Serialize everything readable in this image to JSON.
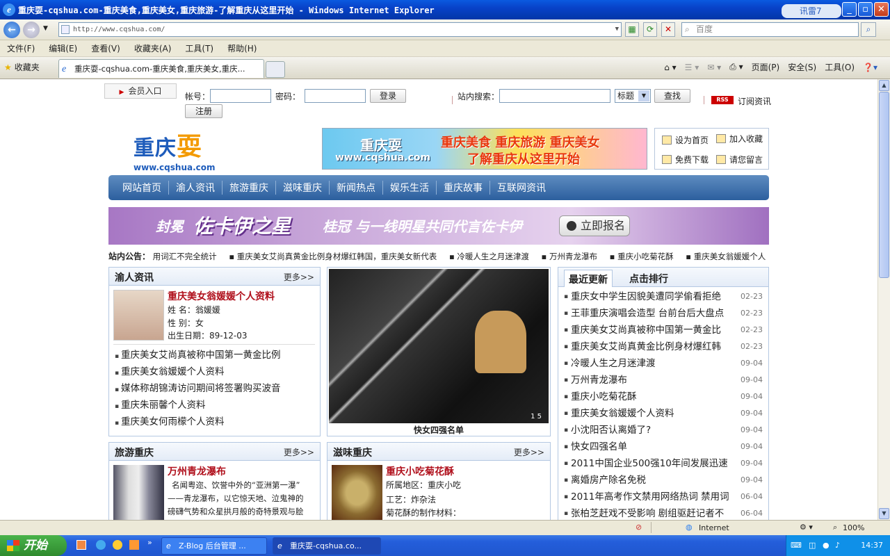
{
  "window": {
    "title": "重庆耍-cqshua.com-重庆美食,重庆美女,重庆旅游-了解重庆从这里开始 - Windows Internet Explorer",
    "xunlei": "讯雷7"
  },
  "browser": {
    "address": "http://www.cqshua.com/",
    "search_placeholder": "百度",
    "menus": [
      "文件(F)",
      "编辑(E)",
      "查看(V)",
      "收藏夹(A)",
      "工具(T)",
      "帮助(H)"
    ],
    "favorites": "收藏夹",
    "tab_title": "重庆耍-cqshua.com-重庆美食,重庆美女,重庆...",
    "cmd": {
      "page": "页面(P)",
      "safety": "安全(S)",
      "tools": "工具(O)"
    }
  },
  "page": {
    "member": "会员入口",
    "account_label": "帐号：",
    "password_label": "密码：",
    "login": "登录",
    "register": "注册",
    "site_search_label": "站内搜索：",
    "search_type": "标题",
    "search_btn": "查找",
    "rss_badge": "RSS",
    "rss_label": "订阅资讯",
    "logo_main": "重庆",
    "logo_accent": "耍",
    "logo_url": "www.cqshua.com",
    "banner_top": {
      "a": "重庆耍",
      "b": "www.cqshua.com",
      "c": "重庆美食 重庆旅游 重庆美女",
      "d": "了解重庆从这里开始"
    },
    "quick": {
      "home": "设为首页",
      "fav": "加入收藏",
      "download": "免费下载",
      "message": "请您留言"
    },
    "nav": [
      "网站首页",
      "渝人资讯",
      "旅游重庆",
      "滋味重庆",
      "新闻热点",
      "娱乐生活",
      "重庆故事",
      "互联网资讯"
    ],
    "banner_ad": {
      "t1": "封冕",
      "t2": "佐卡伊之星",
      "t3": "桂冠 与一线明星共同代言佐卡伊",
      "btn": "立即报名"
    },
    "notice": {
      "label": "站内公告：",
      "items": [
        "用词汇不完全统计",
        "重庆美女艾尚真黄金比例身材爆红韩国，重庆美女新代表",
        "冷暖人生之月迷津渡",
        "万州青龙瀑布",
        "重庆小吃菊花酥",
        "重庆美女翁媛媛个人"
      ]
    },
    "yuren": {
      "title": "渝人资讯",
      "more": "更多>>",
      "headline": "重庆美女翁媛媛个人资料",
      "name": "姓  名：翁媛媛",
      "sex": "性  别：女",
      "birth": "出生日期：89-12-03",
      "list": [
        "重庆美女艾尚真被称中国第一黄金比例",
        "重庆美女翁媛媛个人资料",
        "媒体称胡锦涛访问期间将签署购买波音",
        "重庆朱丽馨个人资料",
        "重庆美女何雨檬个人资料"
      ]
    },
    "slide": {
      "caption": "快女四强名单",
      "pager": "1  5"
    },
    "latest": {
      "tab1": "最近更新",
      "tab2": "点击排行",
      "items": [
        {
          "t": "重庆女中学生因貌美遭同学偷看拒绝",
          "d": "02-23"
        },
        {
          "t": "王菲重庆演唱会造型 台前台后大盘点",
          "d": "02-23"
        },
        {
          "t": "重庆美女艾尚真被称中国第一黄金比",
          "d": "02-23"
        },
        {
          "t": "重庆美女艾尚真黄金比例身材爆红韩",
          "d": "02-23"
        },
        {
          "t": "冷暖人生之月迷津渡",
          "d": "09-04"
        },
        {
          "t": "万州青龙瀑布",
          "d": "09-04"
        },
        {
          "t": "重庆小吃菊花酥",
          "d": "09-04"
        },
        {
          "t": "重庆美女翁媛媛个人资料",
          "d": "09-04"
        },
        {
          "t": "小沈阳否认离婚了?",
          "d": "09-04"
        },
        {
          "t": "快女四强名单",
          "d": "09-04"
        },
        {
          "t": "2011中国企业500强10年间发展迅速",
          "d": "09-04"
        },
        {
          "t": "离婚房产除名免税",
          "d": "09-04"
        },
        {
          "t": "2011年高考作文禁用网络热词  禁用词",
          "d": "06-04"
        },
        {
          "t": "张柏芝赶戏不受影响 剧组驱赶记者不",
          "d": "06-04"
        }
      ]
    },
    "travel": {
      "title": "旅游重庆",
      "more": "更多>>",
      "headline": "万州青龙瀑布",
      "desc": [
        "名闻粤迩、饮誉中外的“亚洲第一瀑”",
        "——青龙瀑布，以它惊天地、泣鬼神的",
        "磅礴气势和众星拱月般的奇特景观与脍"
      ]
    },
    "taste": {
      "title": "滋味重庆",
      "more": "更多>>",
      "headline": "重庆小吃菊花酥",
      "area": "所属地区：重庆小吃",
      "craft": "工艺：炸杂法",
      "material": "菊花酥的制作材料："
    }
  },
  "status": {
    "zone": "Internet",
    "zoom": "100%"
  },
  "taskbar": {
    "start": "开始",
    "tasks": [
      "Z-Blog 后台管理 ...",
      "重庆耍-cqshua.co..."
    ],
    "time": "14:37"
  }
}
